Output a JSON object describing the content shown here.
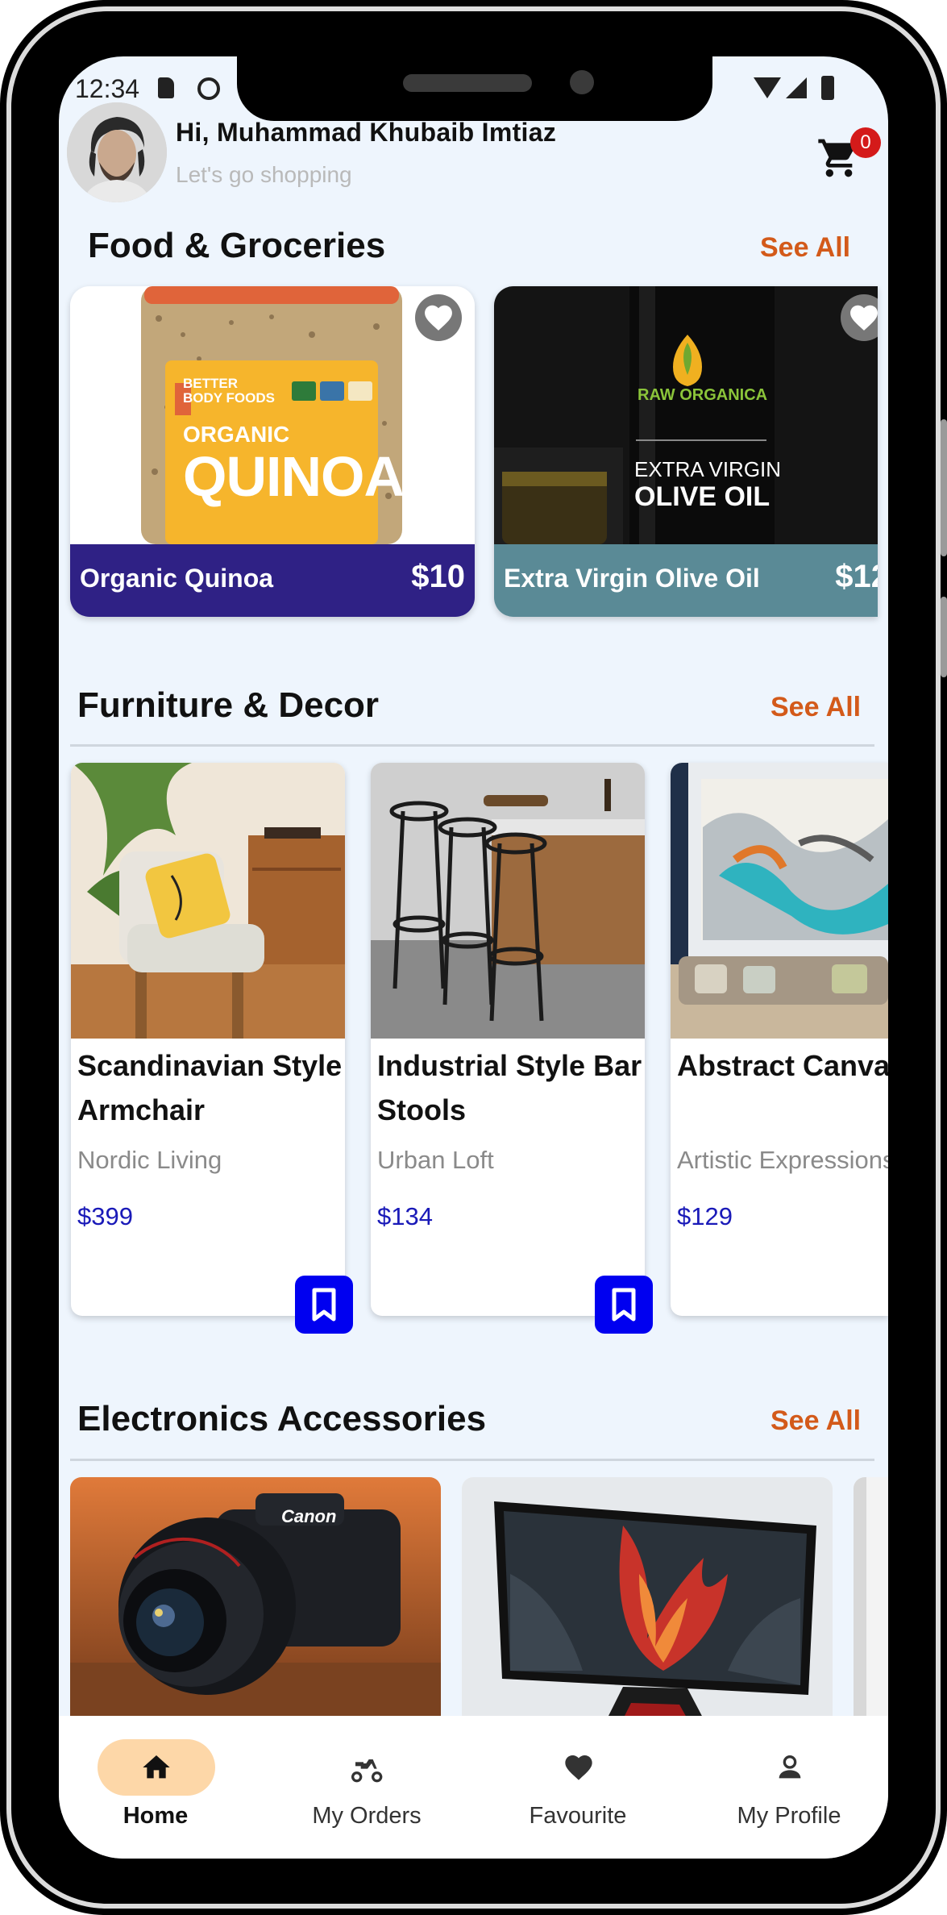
{
  "status_bar": {
    "time": "12:34"
  },
  "header": {
    "greeting": "Hi, Muhammad Khubaib Imtiaz",
    "subtitle": "Let's go shopping",
    "cart_count": "0"
  },
  "food_section": {
    "title": "Food & Groceries",
    "see_all": "See All",
    "items": [
      {
        "name": "Organic Quinoa",
        "price": "$10",
        "bar_color": "#2f2185"
      },
      {
        "name": "Extra Virgin Olive Oil",
        "price": "$12",
        "bar_color": "#5a8a96"
      }
    ],
    "quinoa_label": {
      "brand": "BETTER BODY FOODS",
      "line1": "ORGANIC",
      "line2": "QUINOA"
    },
    "olive_label": {
      "brand": "RAW ORGANICA",
      "line1": "EXTRA VIRGIN",
      "line2": "OLIVE OIL"
    }
  },
  "furniture_section": {
    "title": "Furniture & Decor",
    "see_all": "See All",
    "items": [
      {
        "name": "Scandinavian Style Armchair",
        "brand": "Nordic Living",
        "price": "$399"
      },
      {
        "name": "Industrial Style Bar Stools",
        "brand": "Urban Loft",
        "price": "$134"
      },
      {
        "name": "Abstract Canvas Wall Art",
        "brand": "Artistic Expressions",
        "price": "$129"
      }
    ]
  },
  "electronics_section": {
    "title": "Electronics Accessories",
    "see_all": "See All",
    "camera_brand": "Canon"
  },
  "bottom_nav": {
    "items": [
      {
        "label": "Home",
        "icon": "home-icon",
        "active": true
      },
      {
        "label": "My Orders",
        "icon": "scooter-icon",
        "active": false
      },
      {
        "label": "Favourite",
        "icon": "heart-icon",
        "active": false
      },
      {
        "label": "My Profile",
        "icon": "person-icon",
        "active": false
      }
    ],
    "active_color": "#fdd7a8"
  },
  "colors": {
    "accent_orange": "#d35a1a",
    "bookmark_blue": "#0000f0",
    "price_blue": "#1a1ab8",
    "background": "#eef5fd"
  }
}
